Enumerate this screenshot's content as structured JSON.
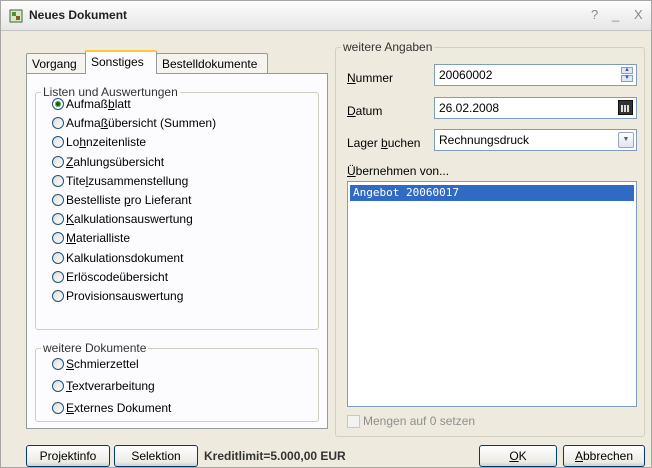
{
  "window": {
    "title": "Neues Dokument",
    "help_btn": "?",
    "min_btn": "_",
    "close_btn": "X"
  },
  "tabs": [
    {
      "label": "Vorgang"
    },
    {
      "label": "Sonstiges"
    },
    {
      "label": "Bestelldokumente"
    }
  ],
  "listen_group": {
    "legend": "Listen und Auswertungen",
    "options": [
      {
        "pre": "Aufmaß",
        "acc": "b",
        "post": "latt",
        "checked": true
      },
      {
        "pre": "Aufma",
        "acc": "ß",
        "post": "übersicht (Summen)",
        "checked": false
      },
      {
        "pre": "Lo",
        "acc": "h",
        "post": "nzeitenliste",
        "checked": false
      },
      {
        "pre": "",
        "acc": "Z",
        "post": "ahlungsübersicht",
        "checked": false
      },
      {
        "pre": "Tite",
        "acc": "l",
        "post": "zusammenstellung",
        "checked": false
      },
      {
        "pre": "Bestelliste ",
        "acc": "p",
        "post": "ro Lieferant",
        "checked": false
      },
      {
        "pre": "",
        "acc": "K",
        "post": "alkulationsauswertung",
        "checked": false
      },
      {
        "pre": "",
        "acc": "M",
        "post": "aterialliste",
        "checked": false
      },
      {
        "pre": "Kalkulationsdokument",
        "acc": "",
        "post": "",
        "checked": false
      },
      {
        "pre": "Erlöscodeübersicht",
        "acc": "",
        "post": "",
        "checked": false
      },
      {
        "pre": "Provisionsauswertung",
        "acc": "",
        "post": "",
        "checked": false
      }
    ]
  },
  "dokumente_group": {
    "legend": "weitere Dokumente",
    "options": [
      {
        "pre": "",
        "acc": "S",
        "post": "chmierzettel",
        "checked": false
      },
      {
        "pre": "",
        "acc": "T",
        "post": "extverarbeitung",
        "checked": false
      },
      {
        "pre": "",
        "acc": "E",
        "post": "xternes Dokument",
        "checked": false
      }
    ]
  },
  "angaben": {
    "legend": "weitere Angaben",
    "nummer_label_acc": "N",
    "nummer_label_rest": "ummer",
    "nummer_value": "20060002",
    "datum_label_acc": "D",
    "datum_label_rest": "atum",
    "datum_value": "26.02.2008",
    "lager_label_pre": "Lager ",
    "lager_label_acc": "b",
    "lager_label_rest": "uchen",
    "lager_value": "Rechnungsdruck",
    "uebernehmen_acc": "Ü",
    "uebernehmen_rest": "bernehmen von...",
    "list_items": [
      "Angebot 20060017"
    ],
    "mengen_label": "Mengen auf 0 setzen"
  },
  "footer": {
    "projektinfo": "Projektinfo",
    "selektion": "Selektion",
    "kreditlimit": "Kreditlimit=5.000,00 EUR",
    "ok_acc": "O",
    "ok_rest": "K",
    "abbrechen_acc": "A",
    "abbrechen_rest": "bbrechen"
  }
}
